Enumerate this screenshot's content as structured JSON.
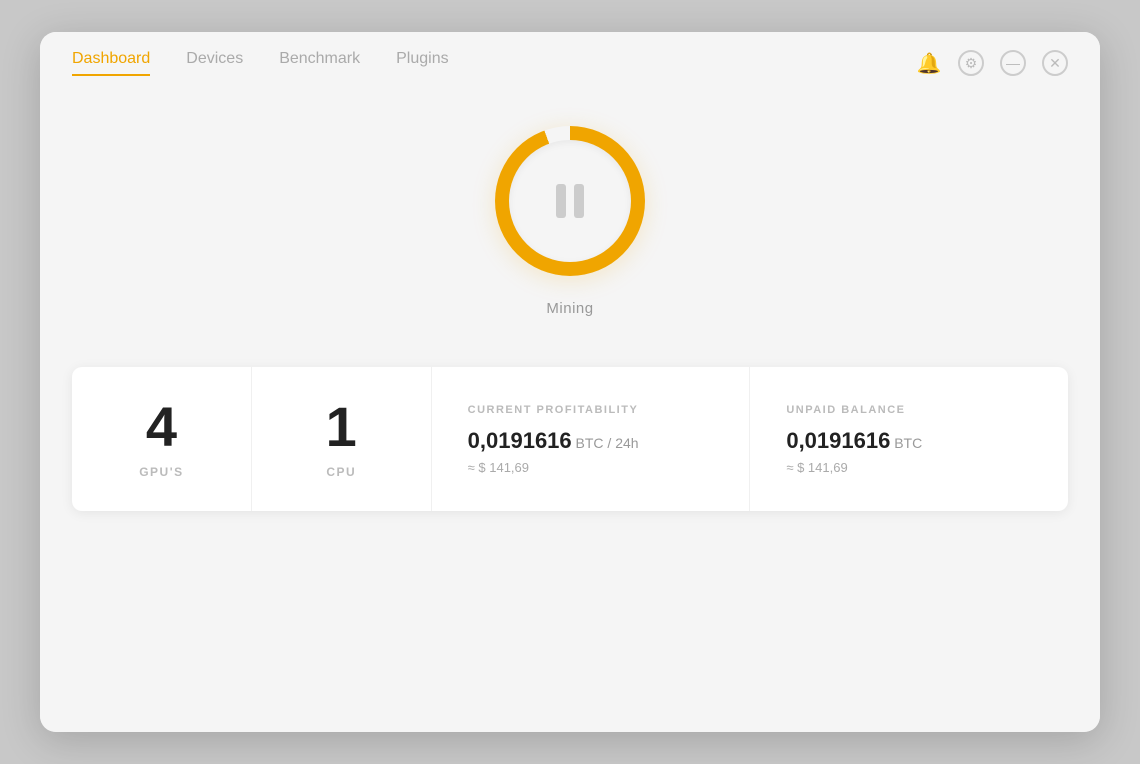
{
  "nav": {
    "items": [
      {
        "id": "dashboard",
        "label": "Dashboard",
        "active": true
      },
      {
        "id": "devices",
        "label": "Devices",
        "active": false
      },
      {
        "id": "benchmark",
        "label": "Benchmark",
        "active": false
      },
      {
        "id": "plugins",
        "label": "Plugins",
        "active": false
      }
    ]
  },
  "windowControls": {
    "bell_label": "🔔",
    "gear_label": "⚙",
    "minimize_label": "—",
    "close_label": "✕"
  },
  "miningButton": {
    "status_label": "Mining"
  },
  "stats": {
    "gpu_count": "4",
    "gpu_label": "GPU'S",
    "cpu_count": "1",
    "cpu_label": "CPU",
    "profitability": {
      "title": "CURRENT PROFITABILITY",
      "value": "0,0191616",
      "unit": " BTC / 24h",
      "approx": "≈ $ 141,69"
    },
    "balance": {
      "title": "UNPAID BALANCE",
      "value": "0,0191616",
      "unit": " BTC",
      "approx": "≈ $ 141,69"
    }
  }
}
